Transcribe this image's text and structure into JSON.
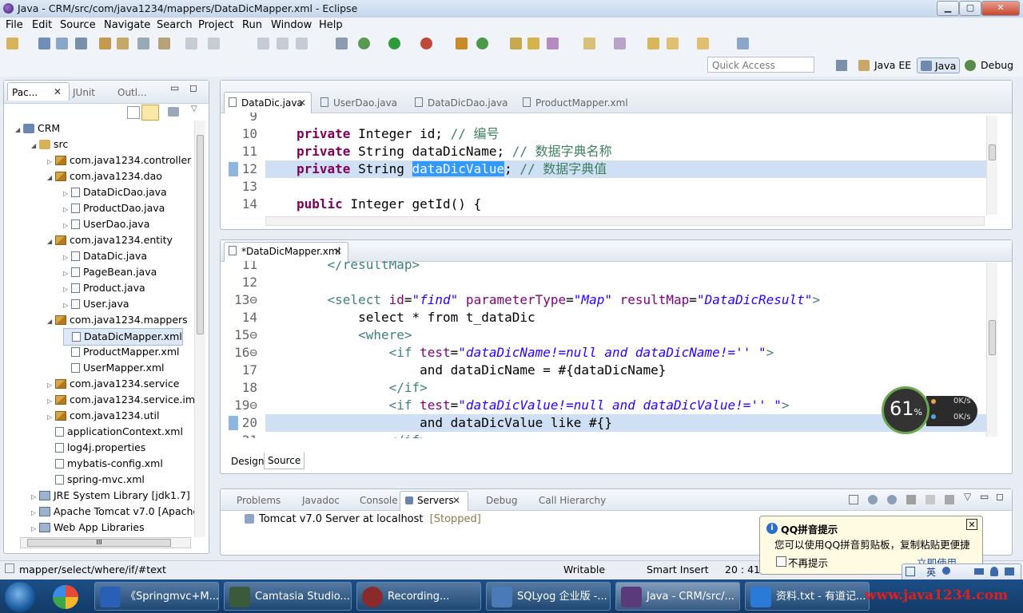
{
  "window": {
    "title": "Java - CRM/src/com/java1234/mappers/DataDicMapper.xml - Eclipse",
    "min": "▁",
    "max": "▢",
    "close": "✕"
  },
  "menu": [
    "File",
    "Edit",
    "Source",
    "Navigate",
    "Search",
    "Project",
    "Run",
    "Window",
    "Help"
  ],
  "quick_access": {
    "placeholder": "Quick Access"
  },
  "perspectives": [
    "Java EE",
    "Java",
    "Debug"
  ],
  "explorer": {
    "tabs": [
      "Pac...",
      "JUnit",
      "Outl..."
    ],
    "tree": [
      {
        "label": "CRM",
        "indent": 0,
        "twisty": "◢",
        "icon": "proj"
      },
      {
        "label": "src",
        "indent": 1,
        "twisty": "◢",
        "icon": "src"
      },
      {
        "label": "com.java1234.controller",
        "indent": 2,
        "twisty": "▷",
        "icon": "pkg"
      },
      {
        "label": "com.java1234.dao",
        "indent": 2,
        "twisty": "◢",
        "icon": "pkg"
      },
      {
        "label": "DataDicDao.java",
        "indent": 3,
        "twisty": "▷",
        "icon": "java"
      },
      {
        "label": "ProductDao.java",
        "indent": 3,
        "twisty": "▷",
        "icon": "java"
      },
      {
        "label": "UserDao.java",
        "indent": 3,
        "twisty": "▷",
        "icon": "java"
      },
      {
        "label": "com.java1234.entity",
        "indent": 2,
        "twisty": "◢",
        "icon": "pkg"
      },
      {
        "label": "DataDic.java",
        "indent": 3,
        "twisty": "▷",
        "icon": "java"
      },
      {
        "label": "PageBean.java",
        "indent": 3,
        "twisty": "▷",
        "icon": "java"
      },
      {
        "label": "Product.java",
        "indent": 3,
        "twisty": "▷",
        "icon": "java"
      },
      {
        "label": "User.java",
        "indent": 3,
        "twisty": "▷",
        "icon": "java"
      },
      {
        "label": "com.java1234.mappers",
        "indent": 2,
        "twisty": "◢",
        "icon": "pkg"
      },
      {
        "label": "DataDicMapper.xml",
        "indent": 3,
        "twisty": "",
        "icon": "xml",
        "selected": true
      },
      {
        "label": "ProductMapper.xml",
        "indent": 3,
        "twisty": "",
        "icon": "xml"
      },
      {
        "label": "UserMapper.xml",
        "indent": 3,
        "twisty": "",
        "icon": "xml"
      },
      {
        "label": "com.java1234.service",
        "indent": 2,
        "twisty": "▷",
        "icon": "pkg"
      },
      {
        "label": "com.java1234.service.imp",
        "indent": 2,
        "twisty": "▷",
        "icon": "pkg"
      },
      {
        "label": "com.java1234.util",
        "indent": 2,
        "twisty": "▷",
        "icon": "pkg"
      },
      {
        "label": "applicationContext.xml",
        "indent": 2,
        "twisty": "",
        "icon": "xml"
      },
      {
        "label": "log4j.properties",
        "indent": 2,
        "twisty": "",
        "icon": "xml"
      },
      {
        "label": "mybatis-config.xml",
        "indent": 2,
        "twisty": "",
        "icon": "xml"
      },
      {
        "label": "spring-mvc.xml",
        "indent": 2,
        "twisty": "",
        "icon": "xml"
      },
      {
        "label": "JRE System Library [jdk1.7]",
        "indent": 1,
        "twisty": "▷",
        "icon": "lib"
      },
      {
        "label": "Apache Tomcat v7.0 [Apache",
        "indent": 1,
        "twisty": "▷",
        "icon": "lib"
      },
      {
        "label": "Web App Libraries",
        "indent": 1,
        "twisty": "▷",
        "icon": "lib"
      }
    ],
    "hscroll_label": "III"
  },
  "editor_top": {
    "tabs": [
      "DataDic.java",
      "UserDao.java",
      "DataDicDao.java",
      "ProductMapper.xml"
    ],
    "lines": [
      {
        "n": "9",
        "parts": []
      },
      {
        "n": "10",
        "parts": [
          [
            "kw",
            "private "
          ],
          [
            "",
            "Integer id; "
          ],
          [
            "cm",
            "// 编号"
          ]
        ]
      },
      {
        "n": "11",
        "parts": [
          [
            "kw",
            "private "
          ],
          [
            "",
            "String dataDicName; "
          ],
          [
            "cm",
            "// 数据字典名称"
          ]
        ]
      },
      {
        "n": "12",
        "parts": [
          [
            "kw",
            "private "
          ],
          [
            "",
            "String "
          ],
          [
            "selword",
            "dataDicValue"
          ],
          [
            "",
            "; "
          ],
          [
            "cm",
            "// 数据字典值"
          ]
        ],
        "hl": true
      },
      {
        "n": "13",
        "parts": []
      },
      {
        "n": "14",
        "parts": [
          [
            "kw",
            "public "
          ],
          [
            "",
            "Integer getId() {"
          ]
        ]
      }
    ]
  },
  "editor_bottom": {
    "tab": "*DataDicMapper.xml",
    "lines": [
      {
        "n": "11",
        "parts": [
          [
            "",
            "    "
          ],
          [
            "tg",
            "</resultMap>"
          ]
        ]
      },
      {
        "n": "12",
        "parts": []
      },
      {
        "n": "13⊖",
        "parts": [
          [
            "",
            "    "
          ],
          [
            "tg",
            "<select "
          ],
          [
            "at",
            "id"
          ],
          [
            "",
            "="
          ],
          [
            "av",
            "\"find\""
          ],
          [
            "at",
            " parameterType"
          ],
          [
            "",
            "="
          ],
          [
            "av",
            "\"Map\""
          ],
          [
            "at",
            " resultMap"
          ],
          [
            "",
            "="
          ],
          [
            "av",
            "\"DataDicResult\""
          ],
          [
            "tg",
            ">"
          ]
        ]
      },
      {
        "n": "14",
        "parts": [
          [
            "",
            "        select * from t_dataDic"
          ]
        ]
      },
      {
        "n": "15⊖",
        "parts": [
          [
            "",
            "        "
          ],
          [
            "tg",
            "<where>"
          ]
        ]
      },
      {
        "n": "16⊖",
        "parts": [
          [
            "",
            "            "
          ],
          [
            "tg",
            "<if "
          ],
          [
            "at",
            "test"
          ],
          [
            "",
            "="
          ],
          [
            "av",
            "\"dataDicName!=null and dataDicName!='' \""
          ],
          [
            "tg",
            ">"
          ]
        ]
      },
      {
        "n": "17",
        "parts": [
          [
            "",
            "                and dataDicName = #{dataDicName}"
          ]
        ]
      },
      {
        "n": "18",
        "parts": [
          [
            "",
            "            "
          ],
          [
            "tg",
            "</if>"
          ]
        ]
      },
      {
        "n": "19⊖",
        "parts": [
          [
            "",
            "            "
          ],
          [
            "tg",
            "<if "
          ],
          [
            "at",
            "test"
          ],
          [
            "",
            "="
          ],
          [
            "av",
            "\"dataDicValue!=null and dataDicValue!='' \""
          ],
          [
            "tg",
            ">"
          ]
        ]
      },
      {
        "n": "20",
        "parts": [
          [
            "",
            "                and dataDicValue like #{}"
          ]
        ],
        "hl": true
      },
      {
        "n": "21",
        "parts": [
          [
            "",
            "            "
          ],
          [
            "tg",
            "</if>"
          ]
        ]
      }
    ],
    "design_tab": "Design",
    "source_tab": "Source"
  },
  "bottom_panel": {
    "tabs": [
      "Problems",
      "Javadoc",
      "Console",
      "Servers",
      "Debug",
      "Call Hierarchy"
    ],
    "server": "Tomcat v7.0 Server at localhost",
    "server_state": "[Stopped]"
  },
  "status": {
    "path": "mapper/select/where/if/#text",
    "writable": "Writable",
    "insert": "Smart Insert",
    "pos": "20 : 41"
  },
  "widget": {
    "percent": "61",
    "unit": "%",
    "up": "0K/s",
    "down": "0K/s"
  },
  "qq": {
    "title": "QQ拼音提示",
    "body": "您可以使用QQ拼音剪贴板，复制粘贴更便捷",
    "checkbox": "不再提示",
    "link": "立即使用",
    "ime": "英"
  },
  "taskbar": {
    "tasks": [
      "《Springmvc+M...",
      "Camtasia Studio...",
      "Recording...",
      "SQLyog 企业版 -...",
      "Java - CRM/src/...",
      "资料.txt - 有道记..."
    ],
    "watermark": "www.java1234.com"
  },
  "colors": {
    "keyword": "#7f0055",
    "comment": "#3f7f5f",
    "tag": "#3f7f7f",
    "attr": "#7f007f",
    "value": "#2a00ff"
  }
}
